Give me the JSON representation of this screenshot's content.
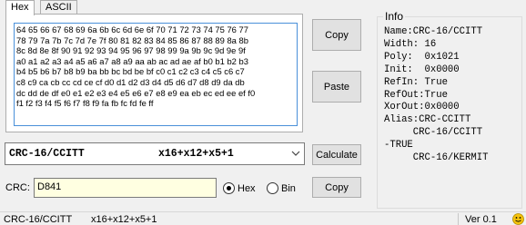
{
  "tabs": [
    {
      "label": "Hex",
      "active": true
    },
    {
      "label": "ASCII",
      "active": false
    }
  ],
  "hex_lines": [
    "64 65 66 67 68 69 6a 6b 6c 6d 6e 6f 70 71 72 73 74 75 76 77",
    "78 79 7a 7b 7c 7d 7e 7f 80 81 82 83 84 85 86 87 88 89 8a 8b",
    "8c 8d 8e 8f 90 91 92 93 94 95 96 97 98 99 9a 9b 9c 9d 9e 9f",
    "a0 a1 a2 a3 a4 a5 a6 a7 a8 a9 aa ab ac ad ae af b0 b1 b2 b3",
    "b4 b5 b6 b7 b8 b9 ba bb bc bd be bf c0 c1 c2 c3 c4 c5 c6 c7",
    "c8 c9 ca cb cc cd ce cf d0 d1 d2 d3 d4 d5 d6 d7 d8 d9 da db",
    "dc dd de df e0 e1 e2 e3 e4 e5 e6 e7 e8 e9 ea eb ec ed ee ef f0",
    "f1 f2 f3 f4 f5 f6 f7 f8 f9 fa fb fc fd fe ff"
  ],
  "buttons": {
    "copy_top": "Copy",
    "paste": "Paste",
    "calculate": "Calculate",
    "copy_bottom": "Copy"
  },
  "algorithm_select": {
    "name": "CRC-16/CCITT",
    "polynomial": "x16+x12+x5+1"
  },
  "crc": {
    "label": "CRC:",
    "value": "D841"
  },
  "format": {
    "hex_label": "Hex",
    "bin_label": "Bin",
    "selected": "Hex"
  },
  "info": {
    "title": "Info",
    "lines": [
      "Name:CRC-16/CCITT",
      "Width: 16",
      "Poly:  0x1021",
      "Init:  0x0000",
      "RefIn: True",
      "RefOut:True",
      "XorOut:0x0000",
      "Alias:CRC-CCITT",
      "     CRC-16/CCITT",
      "-TRUE",
      "     CRC-16/KERMIT"
    ]
  },
  "status": {
    "algorithm": "CRC-16/CCITT",
    "polynomial": "x16+x12+x5+1",
    "version": "Ver 0.1",
    "icon": "smiley-face-icon",
    "icon_color": "#f4c20d"
  }
}
